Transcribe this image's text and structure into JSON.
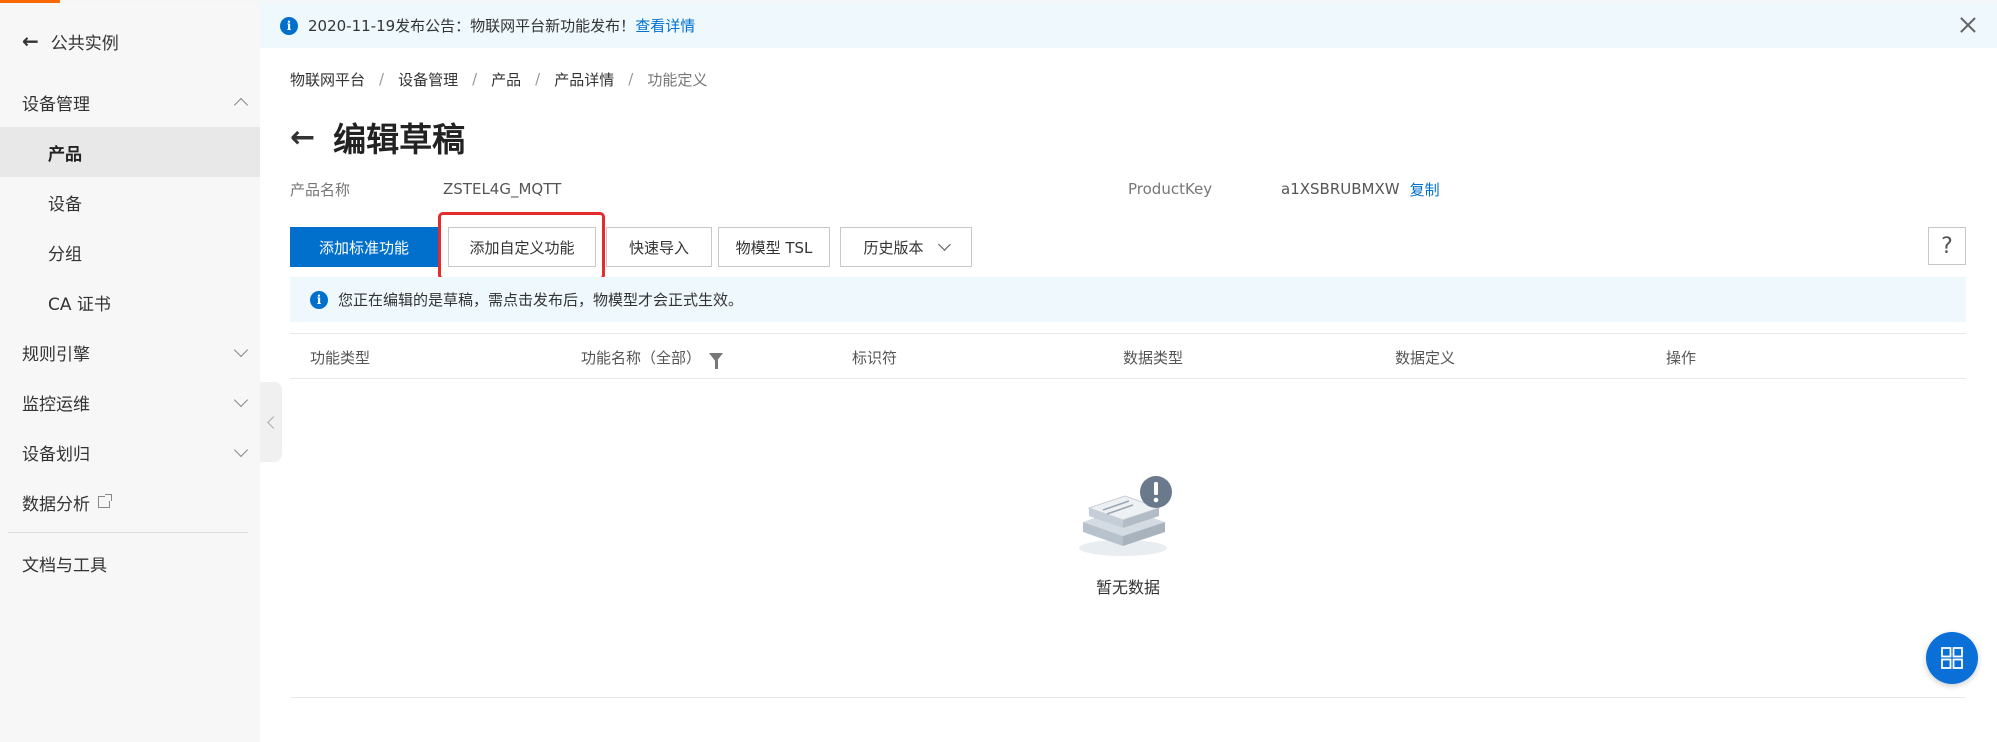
{
  "colors": {
    "accent": "#0070cc",
    "highlight": "#e52b2b",
    "brand_orange": "#ff6a00"
  },
  "sidebar": {
    "back_label": "公共实例",
    "sections": [
      {
        "label": "设备管理",
        "expanded": true
      },
      {
        "label": "规则引擎",
        "expanded": false
      },
      {
        "label": "监控运维",
        "expanded": false
      },
      {
        "label": "设备划归",
        "expanded": false
      },
      {
        "label": "数据分析"
      },
      {
        "label": "文档与工具"
      }
    ],
    "items": [
      {
        "label": "产品",
        "active": true
      },
      {
        "label": "设备"
      },
      {
        "label": "分组"
      },
      {
        "label": "CA 证书"
      }
    ]
  },
  "notice": {
    "text": "2020-11-19发布公告：物联网平台新功能发布！",
    "link": "查看详情"
  },
  "breadcrumb": [
    "物联网平台",
    "设备管理",
    "产品",
    "产品详情",
    "功能定义"
  ],
  "page": {
    "title": "编辑草稿"
  },
  "product": {
    "name_label": "产品名称",
    "name_value": "ZSTEL4G_MQTT",
    "key_label": "ProductKey",
    "key_value": "a1XSBRUBMXW",
    "copy_label": "复制"
  },
  "toolbar": {
    "add_standard": "添加标准功能",
    "add_custom": "添加自定义功能",
    "quick_import": "快速导入",
    "tsl": "物模型 TSL",
    "history": "历史版本",
    "help": "?"
  },
  "draft_note": "您正在编辑的是草稿，需点击发布后，物模型才会正式生效。",
  "table": {
    "columns": [
      "功能类型",
      "功能名称（全部）",
      "标识符",
      "数据类型",
      "数据定义",
      "操作"
    ],
    "rows": [],
    "empty_text": "暂无数据"
  }
}
